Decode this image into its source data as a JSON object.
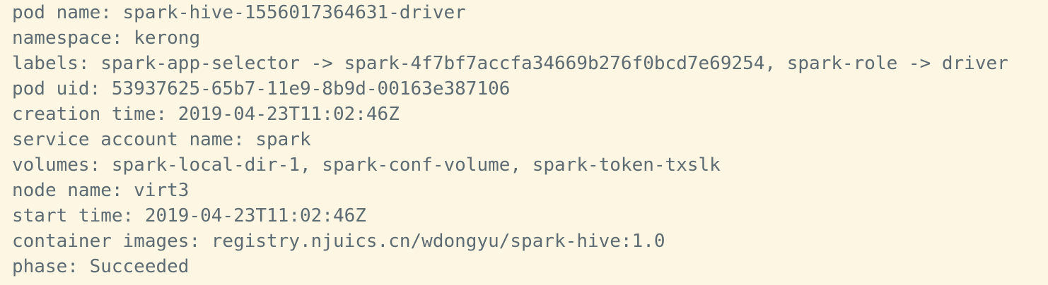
{
  "log": {
    "lines": [
      "pod name: spark-hive-1556017364631-driver",
      "namespace: kerong",
      "labels: spark-app-selector -> spark-4f7bf7accfa34669b276f0bcd7e69254, spark-role -> driver",
      "pod uid: 53937625-65b7-11e9-8b9d-00163e387106",
      "creation time: 2019-04-23T11:02:46Z",
      "service account name: spark",
      "volumes: spark-local-dir-1, spark-conf-volume, spark-token-txslk",
      "node name: virt3",
      "start time: 2019-04-23T11:02:46Z",
      "container images: registry.njuics.cn/wdongyu/spark-hive:1.0",
      "phase: Succeeded"
    ]
  },
  "colors": {
    "background": "#fdf6e3",
    "text": "#5d6b73"
  }
}
